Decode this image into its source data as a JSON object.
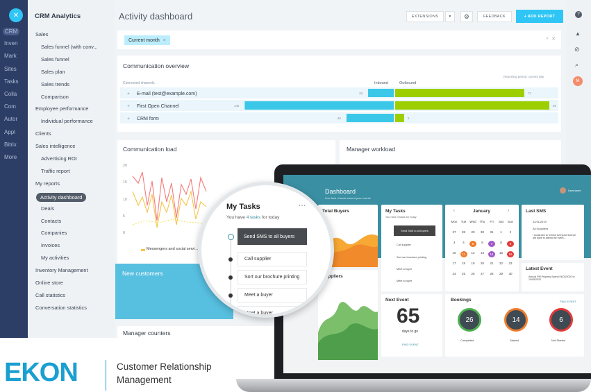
{
  "left_nav": {
    "items": [
      "CRM",
      "Inven",
      "Mark",
      "Sites",
      "Tasks",
      "Colla",
      "Com",
      "Autor",
      "Appl",
      "Bitrix",
      "More"
    ]
  },
  "sidebar": {
    "title": "CRM Analytics",
    "items": [
      {
        "label": "Sales",
        "level": 0
      },
      {
        "label": "Sales funnel (with conv...",
        "level": 1
      },
      {
        "label": "Sales funnel",
        "level": 1
      },
      {
        "label": "Sales plan",
        "level": 1
      },
      {
        "label": "Sales trends",
        "level": 1
      },
      {
        "label": "Comparison",
        "level": 1
      },
      {
        "label": "Employee performance",
        "level": 0
      },
      {
        "label": "Individual performance",
        "level": 1
      },
      {
        "label": "Clients",
        "level": 0
      },
      {
        "label": "Sales intelligence",
        "level": 0
      },
      {
        "label": "Advertising ROI",
        "level": 1
      },
      {
        "label": "Traffic report",
        "level": 1
      },
      {
        "label": "My reports",
        "level": 0
      },
      {
        "label": "Activity dashboard",
        "level": 1,
        "active": true
      },
      {
        "label": "Deals",
        "level": 1
      },
      {
        "label": "Contacts",
        "level": 1
      },
      {
        "label": "Companies",
        "level": 1
      },
      {
        "label": "Invoices",
        "level": 1
      },
      {
        "label": "My activities",
        "level": 1
      },
      {
        "label": "Inventory Management",
        "level": 0
      },
      {
        "label": "Online store",
        "level": 0
      },
      {
        "label": "Call statistics",
        "level": 0
      },
      {
        "label": "Conversation statistics",
        "level": 0
      }
    ]
  },
  "header": {
    "title": "Activity dashboard",
    "extensions": "EXTENSIONS",
    "feedback": "FEEDBACK",
    "add_report": "+ ADD REPORT"
  },
  "filter": {
    "tag": "Current month"
  },
  "overview": {
    "title": "Communication overview",
    "col_channel": "Connected channels",
    "col_in": "Inbound",
    "col_out": "Outbound",
    "period": "Reporting period: current day",
    "rows": [
      {
        "name": "E-mail (test@example.com)",
        "inbound": 25,
        "outbound": 72
      },
      {
        "name": "First Open Channel",
        "inbound": 145,
        "outbound": 86
      },
      {
        "name": "CRM form",
        "inbound": 46,
        "outbound": 5
      }
    ]
  },
  "load": {
    "title": "Communication load",
    "yticks": [
      "20",
      "15",
      "10",
      "5",
      "0"
    ],
    "legend": "Messengers and social servi..."
  },
  "workload": {
    "title": "Manager workload"
  },
  "new_customers": {
    "title": "New customers"
  },
  "manager_counters": {
    "title": "Manager counters"
  },
  "laptop": {
    "title": "Dashboard",
    "subtitle": "Live feed of work around your events",
    "user": "Username",
    "total_buyers": "Total Buyers",
    "suppliers": "Suppliers",
    "tasks": {
      "title": "My Tasks",
      "sub": "You have 4 tasks for today",
      "items": [
        "Send SMS to all buyers",
        "Call supplier",
        "Sort our brochure printing",
        "Meet a buyer",
        "Meet a buyer"
      ]
    },
    "calendar": {
      "month": "January",
      "weekdays": [
        "Mon",
        "Tue",
        "Wed",
        "Thu",
        "Fri",
        "Sat",
        "Sun"
      ],
      "days": [
        "27",
        "28",
        "29",
        "30",
        "31",
        "1",
        "2",
        "3",
        "4",
        "5",
        "6",
        "7",
        "8",
        "9",
        "10",
        "11",
        "12",
        "13",
        "14",
        "15",
        "16",
        "17",
        "18",
        "19",
        "20",
        "21",
        "22",
        "23",
        "24",
        "25",
        "26",
        "27",
        "28",
        "29",
        "30"
      ]
    },
    "last_sms": {
      "title": "Last SMS",
      "date": "02/11/2019",
      "to": "All Suppliers",
      "msg": "I would like to remind everyone that we will have to attend the event..."
    },
    "latest_event": {
      "title": "Latest Event",
      "text": "Annual PM Property Spend 04/03/2020 to 10/05/2020"
    },
    "next_event": {
      "title": "Next Event",
      "number": "65",
      "label": "days to go",
      "link": "FIND EVENT"
    },
    "bookings": {
      "title": "Bookings",
      "link": "FIND EVENT",
      "items": [
        {
          "value": "26",
          "label": "Completed"
        },
        {
          "value": "14",
          "label": "Started"
        },
        {
          "value": "6",
          "label": "Not Started"
        }
      ]
    }
  },
  "magnifier": {
    "title": "My Tasks",
    "sub_pre": "You have ",
    "sub_link": "4 tasks",
    "sub_post": " for today",
    "items": [
      "Send SMS to all buyers",
      "Call supplier",
      "Sort our brochure printing",
      "Meet a buyer",
      "Meet a buyer"
    ]
  },
  "brand": {
    "logo": "EKON",
    "tagline1": "Customer Relationship",
    "tagline2": "Management"
  },
  "colors": {
    "accent": "#2fc6f6",
    "inbound": "#3bc8e8",
    "outbound": "#9dcf00",
    "nav": "#2d3e66",
    "logo": "#1a9fd1"
  }
}
